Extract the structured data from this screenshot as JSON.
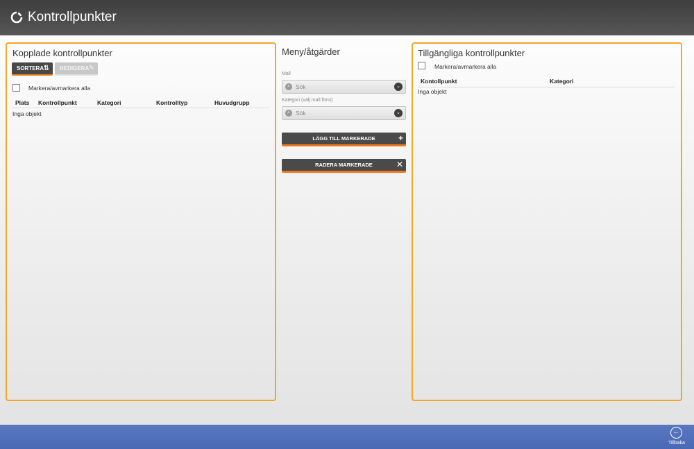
{
  "header": {
    "title": "Kontrollpunkter",
    "logo_icon": "refresh-ring-icon"
  },
  "left_panel": {
    "title": "Kopplade kontrollpunkter",
    "sort_button": {
      "label": "SORTERA",
      "icon": "sort-arrows-icon"
    },
    "edit_button": {
      "label": "REDIGERA",
      "icon": "pencil-icon",
      "disabled": true
    },
    "select_all_label": "Markera/avmarkera alla",
    "columns": [
      "Plats",
      "Kontrollpunkt",
      "Kategori",
      "Kontrolltyp",
      "Huvudgrupp"
    ],
    "empty_text": "Inga objekt"
  },
  "middle_panel": {
    "title": "Meny/åtgärder",
    "mall": {
      "label": "Mall",
      "placeholder": "Sök"
    },
    "kategori": {
      "label": "Kategori (välj mall först)",
      "placeholder": "Sök"
    },
    "add_button": {
      "label": "LÄGG TILL MARKERADE",
      "icon": "plus-icon"
    },
    "delete_button": {
      "label": "RADERA MARKERADE",
      "icon": "close-icon"
    }
  },
  "right_panel": {
    "title": "Tillgängliga kontrollpunkter",
    "select_all_label": "Markera/avmarkera alla",
    "columns": [
      "Kontollpunkt",
      "Kategori"
    ],
    "empty_text": "Inga objekt"
  },
  "footer": {
    "back_label": "Tillbaka",
    "back_icon": "back-arrow-icon"
  },
  "colors": {
    "accent": "#f5a623",
    "header_bg": "#474747",
    "footer_bg": "#5070b8",
    "button_dark": "#484848"
  }
}
